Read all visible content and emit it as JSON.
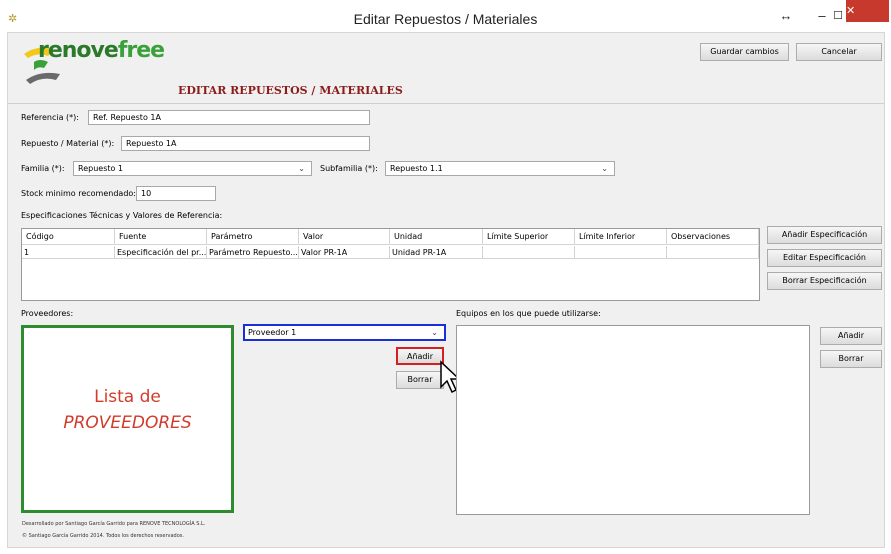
{
  "window": {
    "title": "Editar Repuestos / Materiales",
    "icon": "app-icon",
    "restore_glyph": "↔",
    "minimize_glyph": "–",
    "maximize_glyph": "☐",
    "close_glyph": "✕"
  },
  "logo": {
    "part1": "renove",
    "part2": "free"
  },
  "heading": "EDITAR REPUESTOS / MATERIALES",
  "toolbar": {
    "save_label": "Guardar cambios",
    "cancel_label": "Cancelar"
  },
  "form": {
    "referencia_label": "Referencia (*):",
    "referencia_value": "Ref. Repuesto 1A",
    "repuesto_label": "Repuesto / Material (*):",
    "repuesto_value": "Repuesto 1A",
    "familia_label": "Familia (*):",
    "familia_value": "Repuesto 1",
    "subfamilia_label": "Subfamilia (*):",
    "subfamilia_value": "Repuesto 1.1",
    "stock_label": "Stock minimo recomendado:",
    "stock_value": "10"
  },
  "specs": {
    "section_label": "Especificaciones Técnicas y Valores de Referencia:",
    "columns": [
      "Código",
      "Fuente",
      "Parámetro",
      "Valor",
      "Unidad",
      "Límite Superior",
      "Límite Inferior",
      "Observaciones"
    ],
    "rows": [
      [
        "1",
        "Especificación del pr...",
        "Parámetro Repuesto...",
        "Valor PR-1A",
        "Unidad PR-1A",
        "",
        "",
        ""
      ]
    ],
    "add_label": "Añadir Especificación",
    "edit_label": "Editar Especificación",
    "delete_label": "Borrar Especificación"
  },
  "proveedores": {
    "label": "Proveedores:",
    "overlay_line1": "Lista de",
    "overlay_line2": "PROVEEDORES",
    "combo_value": "Proveedor 1",
    "add_label": "Añadir",
    "delete_label": "Borrar"
  },
  "equipos": {
    "label": "Equipos en los que puede utilizarse:",
    "add_label": "Añadir",
    "delete_label": "Borrar"
  },
  "footer": {
    "line1": "Desarrollado por Santiago García Garrido para RENOVE TECNOLOGÍA S.L.",
    "line2": "© Santiago García Garrido 2014. Todos los derechos reservados."
  },
  "colors": {
    "accent_heading": "#8b1c1c",
    "logo_green": "#2a7a2a",
    "annotation_green": "#2e8b2e",
    "annotation_blue": "#1b2fd6",
    "annotation_red": "#d42020",
    "close_red": "#c7392d"
  }
}
